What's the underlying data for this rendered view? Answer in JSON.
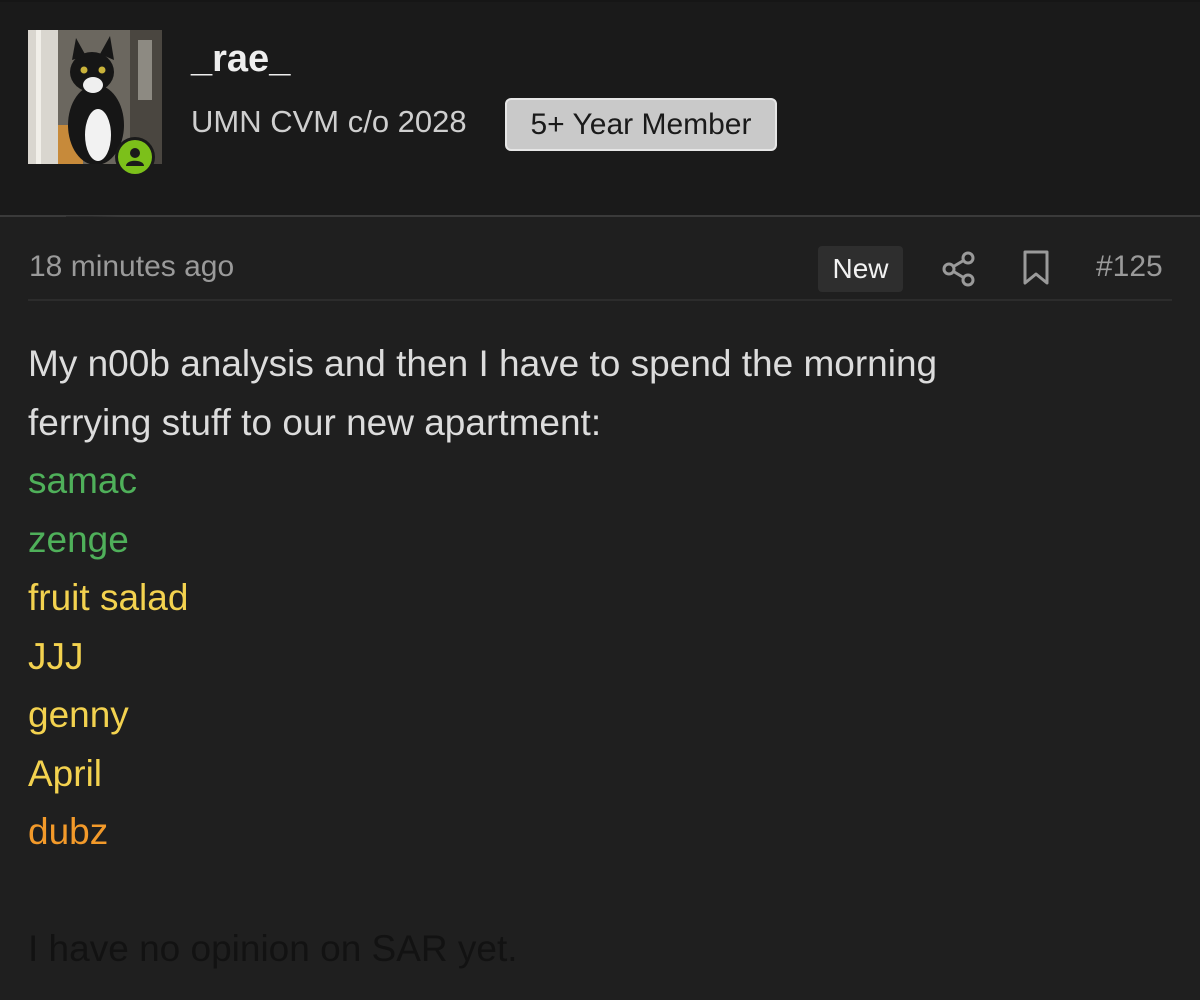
{
  "user": {
    "username": "_rae_",
    "title": "UMN CVM c/o 2028",
    "badge": "5+ Year Member",
    "avatar_icon": "cat-photo-avatar",
    "online_icon": "online-user-icon",
    "online_color": "#7cc01a"
  },
  "post": {
    "timestamp": "18 minutes ago",
    "new_label": "New",
    "share_icon": "share-icon",
    "bookmark_icon": "bookmark-icon",
    "number": "#125",
    "intro_line1": "My n00b analysis and then I have to spend the morning",
    "intro_line2": "ferrying stuff to our new apartment:",
    "items": [
      {
        "text": "samac",
        "color": "#4fb05a"
      },
      {
        "text": "zenge",
        "color": "#4fb05a"
      },
      {
        "text": "fruit salad",
        "color": "#f3d24f"
      },
      {
        "text": "JJJ",
        "color": "#f3d24f"
      },
      {
        "text": "genny",
        "color": "#f3d24f"
      },
      {
        "text": "April",
        "color": "#f3d24f"
      },
      {
        "text": "dubz",
        "color": "#f39a2a"
      }
    ],
    "closing": "I have no opinion on SAR yet.",
    "closing_color": "#121212"
  }
}
